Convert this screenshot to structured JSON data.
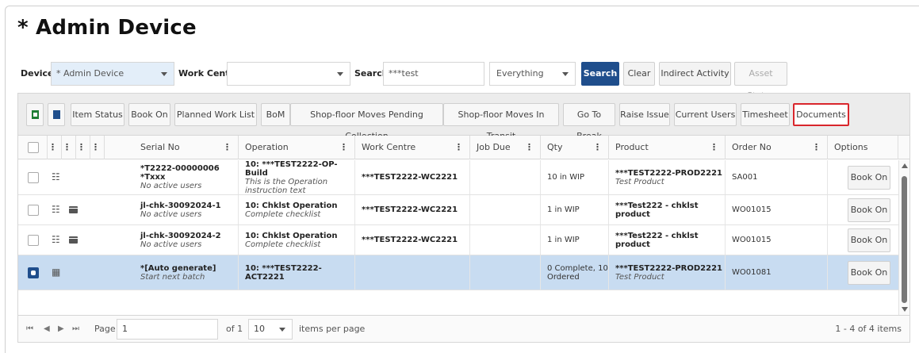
{
  "page": {
    "title": "* Admin Device"
  },
  "filters": {
    "device_label": "Device",
    "device_value": "* Admin Device",
    "work_centre_label": "Work Centre",
    "work_centre_value": "",
    "search_label": "Search",
    "search_value": "***test",
    "scope_value": "Everything",
    "search_button": "Search",
    "clear_button": "Clear",
    "indirect_button": "Indirect Activity",
    "asset_button": "Asset Status"
  },
  "toolbar": {
    "excel_icon": "excel-export-icon",
    "csv_icon": "csv-export-icon",
    "buttons": [
      "Item Status",
      "Book On",
      "Planned Work List",
      "BoM",
      "Shop-floor Moves Pending Collection",
      "Shop-floor Moves In Transit",
      "Go To Break",
      "Raise Issue",
      "Current Users",
      "Timesheet",
      "Documents"
    ],
    "highlight_color": "#d9262c"
  },
  "columns": [
    "Serial No",
    "Operation",
    "Work Centre",
    "Job Due",
    "Qty",
    "Product",
    "Order No",
    "Options"
  ],
  "rows": [
    {
      "serial": "*T2222-00000006 *Txxx",
      "serial_sub": "No active users",
      "op": "10: ***TEST2222-OP-Build",
      "op_sub": "This is the Operation instruction text",
      "wc": "***TEST2222-WC2221",
      "due": "",
      "qty": "10 in WIP",
      "product": "***TEST2222-PROD2221",
      "product_sub": "Test Product",
      "order": "SA001",
      "option": "Book On"
    },
    {
      "serial": "jl-chk-30092024-1",
      "serial_sub": "No active users",
      "op": "10: Chklst Operation",
      "op_sub": "Complete checklist",
      "wc": "***TEST2222-WC2221",
      "due": "",
      "qty": "1 in WIP",
      "product": "***Test222 - chklst product",
      "product_sub": "",
      "order": "WO01015",
      "option": "Book On"
    },
    {
      "serial": "jl-chk-30092024-2",
      "serial_sub": "No active users",
      "op": "10: Chklst Operation",
      "op_sub": "Complete checklist",
      "wc": "***TEST2222-WC2221",
      "due": "",
      "qty": "1 in WIP",
      "product": "***Test222 - chklst product",
      "product_sub": "",
      "order": "WO01015",
      "option": "Book On"
    },
    {
      "serial": "*[Auto generate]",
      "serial_sub": "Start next batch",
      "op": "10: ***TEST2222-ACT2221",
      "op_sub": "",
      "wc": "",
      "due": "",
      "qty": "0 Complete, 10 Ordered",
      "product": "***TEST2222-PROD2221",
      "product_sub": "Test Product",
      "order": "WO01081",
      "option": "Book On"
    }
  ],
  "pager": {
    "page_label": "Page",
    "page_value": "1",
    "of_label": "of 1",
    "page_size": "10",
    "per_page_label": "items per page",
    "summary": "1 - 4 of 4 items"
  }
}
